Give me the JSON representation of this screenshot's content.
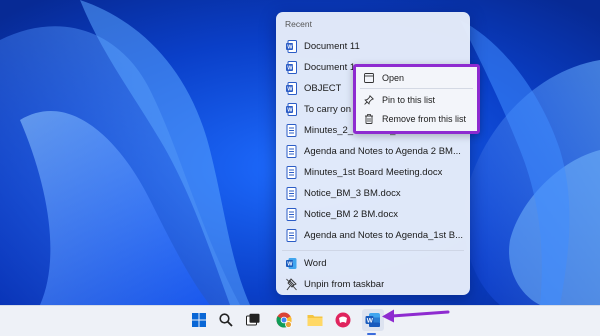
{
  "jumplist": {
    "header": "Recent",
    "recent_items": [
      "Document 11",
      "Document 1",
      "OBJECT",
      "To carry on",
      "Minutes_2_2122025_Minutes.docx",
      "Agenda and Notes to Agenda 2 BM...",
      "Minutes_1st Board Meeting.docx",
      "Notice_BM_3 BM.docx",
      "Notice_BM 2 BM.docx",
      "Agenda and Notes to Agenda_1st B..."
    ],
    "app_label": "Word",
    "unpin_label": "Unpin from taskbar"
  },
  "context_menu": {
    "items": [
      "Open",
      "Pin to this list",
      "Remove from this list"
    ]
  },
  "taskbar": {
    "icons": [
      "windows-start-icon",
      "search-icon",
      "task-view-icon",
      "chrome-icon",
      "file-explorer-icon",
      "app-icon",
      "word-icon"
    ]
  },
  "colors": {
    "highlight": "#8e2bd0",
    "arrow": "#8e2bd0",
    "word_blue": "#2b5cc6"
  }
}
